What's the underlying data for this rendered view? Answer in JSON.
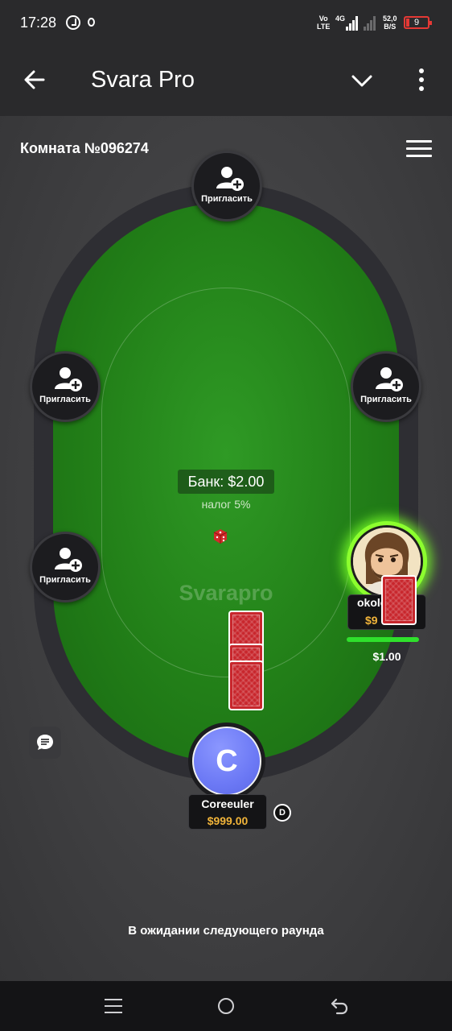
{
  "status_bar": {
    "time": "17:28",
    "volte": "Vo\nLTE",
    "net_type": "4G",
    "net_speed_value": "52,0",
    "net_speed_unit": "B/S",
    "battery": "9",
    "icons": [
      "timer-icon",
      "drop-icon",
      "signal-icon",
      "signal-weak-icon",
      "battery-low-icon"
    ]
  },
  "app_bar": {
    "title": "Svara Pro",
    "icons": [
      "back-arrow-icon",
      "chevron-down-icon",
      "more-vert-icon"
    ]
  },
  "game": {
    "room_label": "Комната №096274",
    "seats": [
      {
        "position": "top",
        "label": "Пригласить"
      },
      {
        "position": "left-upper",
        "label": "Пригласить"
      },
      {
        "position": "right-upper",
        "label": "Пригласить"
      },
      {
        "position": "left-lower",
        "label": "Пригласить"
      }
    ],
    "bank": "Банк: $2.00",
    "tax": "налог 5%",
    "watermark": "Svarapro",
    "opponent": {
      "name": "okolo",
      "chips": "$9",
      "bet": "$1.00",
      "timer_fraction": 0.9
    },
    "hero": {
      "initial": "C",
      "name": "Coreeuler",
      "chips": "$999.00",
      "dealer_badge": "D",
      "hand_card_count": 3
    },
    "status_message": "В ожидании следующего раунда"
  },
  "colors": {
    "felt": "#227f18",
    "rim": "#2e2e33",
    "card_back": "#c8262c",
    "chips_text": "#f1b43a",
    "active_glow": "#8cff2e",
    "hero_avatar": "#6c79f5"
  }
}
